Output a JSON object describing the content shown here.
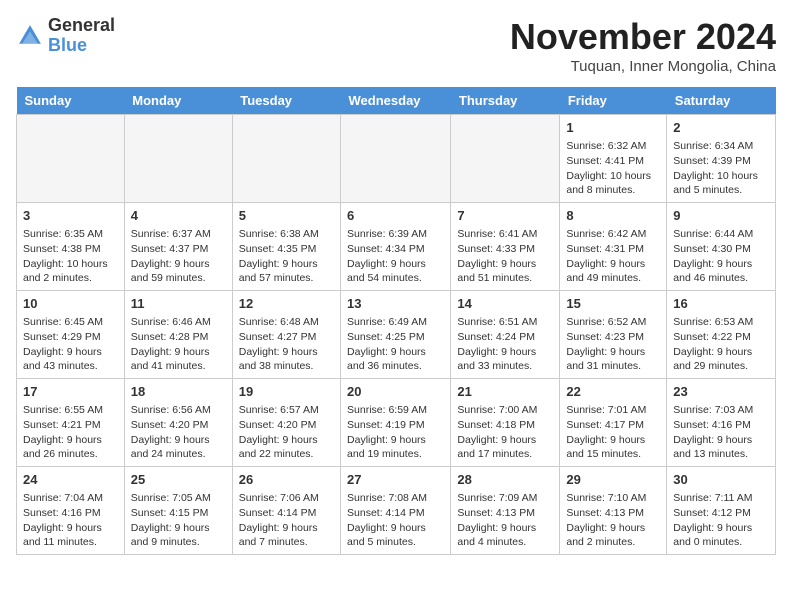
{
  "header": {
    "logo_general": "General",
    "logo_blue": "Blue",
    "month_title": "November 2024",
    "location": "Tuquan, Inner Mongolia, China"
  },
  "days_of_week": [
    "Sunday",
    "Monday",
    "Tuesday",
    "Wednesday",
    "Thursday",
    "Friday",
    "Saturday"
  ],
  "weeks": [
    [
      {
        "day": "",
        "empty": true
      },
      {
        "day": "",
        "empty": true
      },
      {
        "day": "",
        "empty": true
      },
      {
        "day": "",
        "empty": true
      },
      {
        "day": "",
        "empty": true
      },
      {
        "day": "1",
        "sunrise": "6:32 AM",
        "sunset": "4:41 PM",
        "daylight": "10 hours and 8 minutes."
      },
      {
        "day": "2",
        "sunrise": "6:34 AM",
        "sunset": "4:39 PM",
        "daylight": "10 hours and 5 minutes."
      }
    ],
    [
      {
        "day": "3",
        "sunrise": "6:35 AM",
        "sunset": "4:38 PM",
        "daylight": "10 hours and 2 minutes."
      },
      {
        "day": "4",
        "sunrise": "6:37 AM",
        "sunset": "4:37 PM",
        "daylight": "9 hours and 59 minutes."
      },
      {
        "day": "5",
        "sunrise": "6:38 AM",
        "sunset": "4:35 PM",
        "daylight": "9 hours and 57 minutes."
      },
      {
        "day": "6",
        "sunrise": "6:39 AM",
        "sunset": "4:34 PM",
        "daylight": "9 hours and 54 minutes."
      },
      {
        "day": "7",
        "sunrise": "6:41 AM",
        "sunset": "4:33 PM",
        "daylight": "9 hours and 51 minutes."
      },
      {
        "day": "8",
        "sunrise": "6:42 AM",
        "sunset": "4:31 PM",
        "daylight": "9 hours and 49 minutes."
      },
      {
        "day": "9",
        "sunrise": "6:44 AM",
        "sunset": "4:30 PM",
        "daylight": "9 hours and 46 minutes."
      }
    ],
    [
      {
        "day": "10",
        "sunrise": "6:45 AM",
        "sunset": "4:29 PM",
        "daylight": "9 hours and 43 minutes."
      },
      {
        "day": "11",
        "sunrise": "6:46 AM",
        "sunset": "4:28 PM",
        "daylight": "9 hours and 41 minutes."
      },
      {
        "day": "12",
        "sunrise": "6:48 AM",
        "sunset": "4:27 PM",
        "daylight": "9 hours and 38 minutes."
      },
      {
        "day": "13",
        "sunrise": "6:49 AM",
        "sunset": "4:25 PM",
        "daylight": "9 hours and 36 minutes."
      },
      {
        "day": "14",
        "sunrise": "6:51 AM",
        "sunset": "4:24 PM",
        "daylight": "9 hours and 33 minutes."
      },
      {
        "day": "15",
        "sunrise": "6:52 AM",
        "sunset": "4:23 PM",
        "daylight": "9 hours and 31 minutes."
      },
      {
        "day": "16",
        "sunrise": "6:53 AM",
        "sunset": "4:22 PM",
        "daylight": "9 hours and 29 minutes."
      }
    ],
    [
      {
        "day": "17",
        "sunrise": "6:55 AM",
        "sunset": "4:21 PM",
        "daylight": "9 hours and 26 minutes."
      },
      {
        "day": "18",
        "sunrise": "6:56 AM",
        "sunset": "4:20 PM",
        "daylight": "9 hours and 24 minutes."
      },
      {
        "day": "19",
        "sunrise": "6:57 AM",
        "sunset": "4:20 PM",
        "daylight": "9 hours and 22 minutes."
      },
      {
        "day": "20",
        "sunrise": "6:59 AM",
        "sunset": "4:19 PM",
        "daylight": "9 hours and 19 minutes."
      },
      {
        "day": "21",
        "sunrise": "7:00 AM",
        "sunset": "4:18 PM",
        "daylight": "9 hours and 17 minutes."
      },
      {
        "day": "22",
        "sunrise": "7:01 AM",
        "sunset": "4:17 PM",
        "daylight": "9 hours and 15 minutes."
      },
      {
        "day": "23",
        "sunrise": "7:03 AM",
        "sunset": "4:16 PM",
        "daylight": "9 hours and 13 minutes."
      }
    ],
    [
      {
        "day": "24",
        "sunrise": "7:04 AM",
        "sunset": "4:16 PM",
        "daylight": "9 hours and 11 minutes."
      },
      {
        "day": "25",
        "sunrise": "7:05 AM",
        "sunset": "4:15 PM",
        "daylight": "9 hours and 9 minutes."
      },
      {
        "day": "26",
        "sunrise": "7:06 AM",
        "sunset": "4:14 PM",
        "daylight": "9 hours and 7 minutes."
      },
      {
        "day": "27",
        "sunrise": "7:08 AM",
        "sunset": "4:14 PM",
        "daylight": "9 hours and 5 minutes."
      },
      {
        "day": "28",
        "sunrise": "7:09 AM",
        "sunset": "4:13 PM",
        "daylight": "9 hours and 4 minutes."
      },
      {
        "day": "29",
        "sunrise": "7:10 AM",
        "sunset": "4:13 PM",
        "daylight": "9 hours and 2 minutes."
      },
      {
        "day": "30",
        "sunrise": "7:11 AM",
        "sunset": "4:12 PM",
        "daylight": "9 hours and 0 minutes."
      }
    ]
  ]
}
